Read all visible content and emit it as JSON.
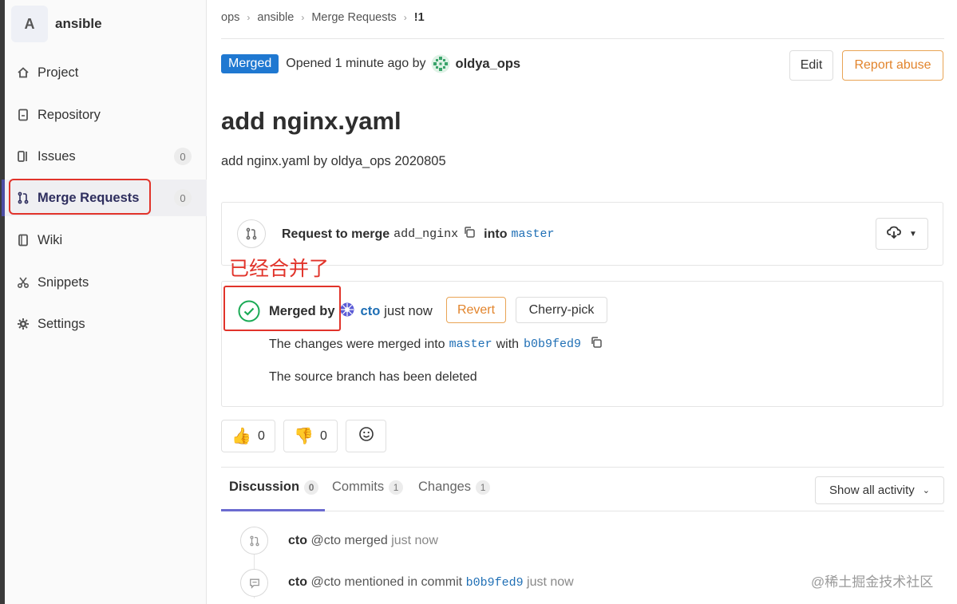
{
  "sidebar": {
    "avatar_letter": "A",
    "project_name": "ansible",
    "items": [
      {
        "label": "Project",
        "icon": "home-icon"
      },
      {
        "label": "Repository",
        "icon": "document-icon"
      },
      {
        "label": "Issues",
        "icon": "issues-icon",
        "count": "0"
      },
      {
        "label": "Merge Requests",
        "icon": "merge-request-icon",
        "count": "0",
        "active": true
      },
      {
        "label": "Wiki",
        "icon": "book-icon"
      },
      {
        "label": "Snippets",
        "icon": "scissors-icon"
      },
      {
        "label": "Settings",
        "icon": "gear-icon"
      }
    ]
  },
  "breadcrumb": [
    "ops",
    "ansible",
    "Merge Requests",
    "!1"
  ],
  "header": {
    "status": "Merged",
    "opened_text": "Opened 1 minute ago by",
    "author": "oldya_ops",
    "edit_label": "Edit",
    "report_label": "Report abuse"
  },
  "mr": {
    "title": "add nginx.yaml",
    "description": "add nginx.yaml by oldya_ops 2020805"
  },
  "merge_request_box": {
    "prefix": "Request to merge",
    "source_branch": "add_nginx",
    "into": "into",
    "target_branch": "master"
  },
  "annotation": "已经合并了",
  "merged_box": {
    "merged_by_label": "Merged by",
    "merger": "cto",
    "when": "just now",
    "revert_label": "Revert",
    "cherry_pick_label": "Cherry-pick",
    "changes_prefix": "The changes were merged into",
    "target_branch": "master",
    "with": "with",
    "commit": "b0b9fed9",
    "branch_deleted": "The source branch has been deleted"
  },
  "reactions": {
    "thumbs_up_count": "0",
    "thumbs_down_count": "0"
  },
  "tabs": [
    {
      "label": "Discussion",
      "count": "0",
      "active": true
    },
    {
      "label": "Commits",
      "count": "1"
    },
    {
      "label": "Changes",
      "count": "1"
    }
  ],
  "activity_filter": "Show all activity",
  "notes": [
    {
      "author": "cto",
      "text": "@cto merged",
      "time": "just now"
    },
    {
      "author": "cto",
      "text": "@cto mentioned in commit",
      "commit": "b0b9fed9",
      "time": "just now"
    }
  ],
  "watermark": "@稀土掘金技术社区",
  "colors": {
    "accent_blue": "#1f78d1",
    "merged_green": "#1aaa55",
    "orange": "#e2842c",
    "annotation_red": "#e1332a",
    "sidebar_active": "#4b4ba3"
  }
}
